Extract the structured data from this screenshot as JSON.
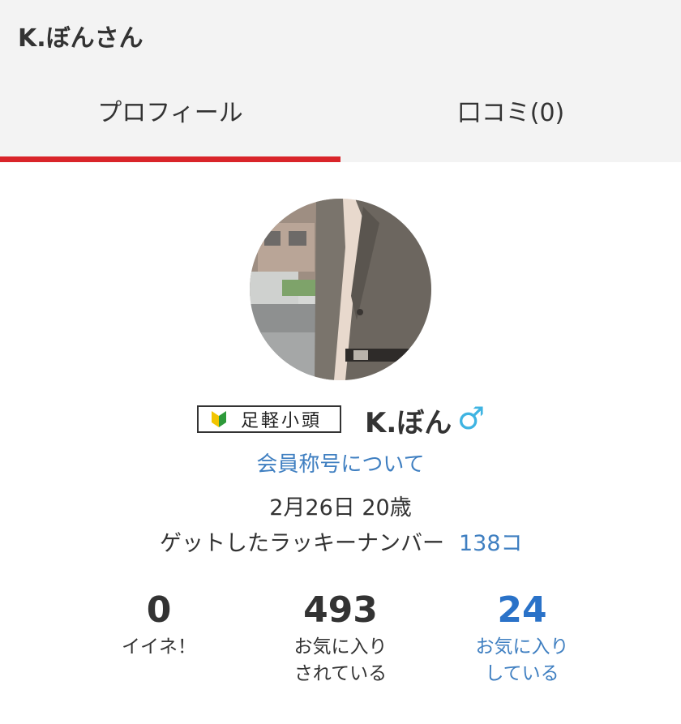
{
  "header": {
    "title": "K.ぼんさん"
  },
  "tabs": [
    {
      "label": "プロフィール",
      "active": true
    },
    {
      "label": "口コミ(0)",
      "active": false
    }
  ],
  "profile": {
    "badge_text": "足軽小頭",
    "username": "K.ぼん",
    "gender_symbol": "♂",
    "member_title_link": "会員称号について",
    "birthday_age": "2月26日 20歳",
    "lucky_label": "ゲットしたラッキーナンバー",
    "lucky_count": "138コ"
  },
  "stats": [
    {
      "value": "0",
      "label_line1": "イイネ！",
      "label_line2": ""
    },
    {
      "value": "493",
      "label_line1": "お気に入り",
      "label_line2": "されている"
    },
    {
      "value": "24",
      "label_line1": "お気に入り",
      "label_line2": "している"
    }
  ],
  "colors": {
    "accent_tab": "#d9242a",
    "link": "#3f7fc1",
    "gender": "#3fb4e2",
    "header_bg": "#f3f3f3"
  }
}
